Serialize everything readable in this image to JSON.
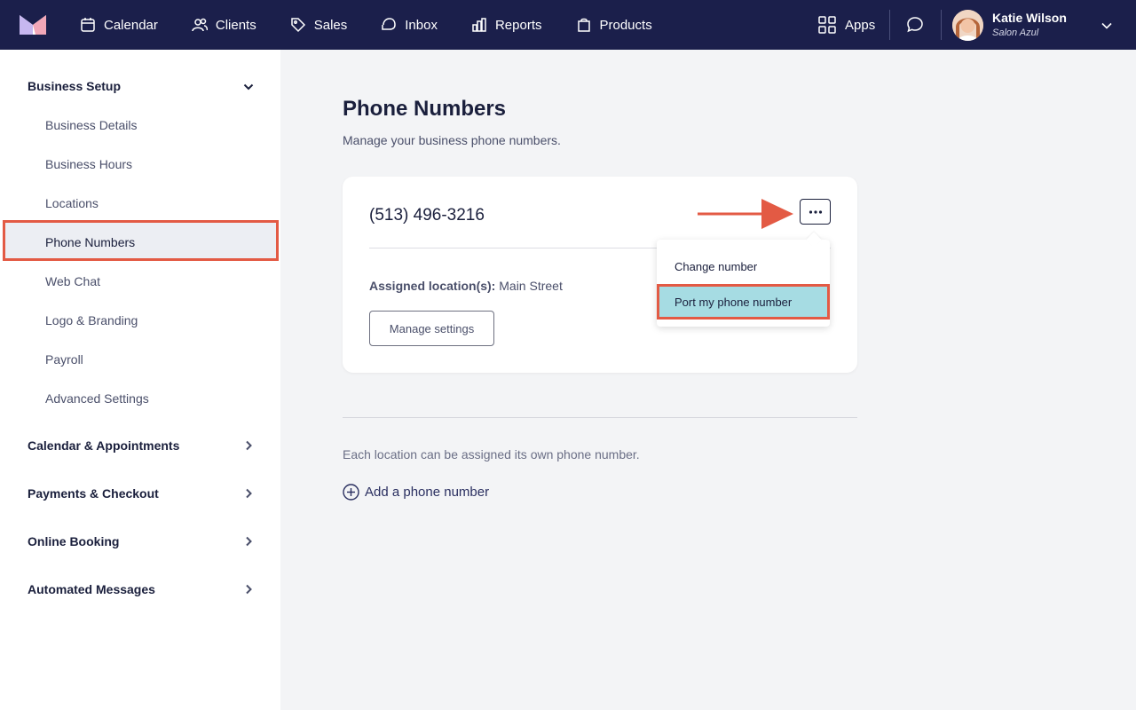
{
  "nav": {
    "items": [
      {
        "label": "Calendar",
        "icon": "calendar-icon"
      },
      {
        "label": "Clients",
        "icon": "clients-icon"
      },
      {
        "label": "Sales",
        "icon": "tag-icon"
      },
      {
        "label": "Inbox",
        "icon": "inbox-icon"
      },
      {
        "label": "Reports",
        "icon": "reports-icon"
      },
      {
        "label": "Products",
        "icon": "bag-icon"
      }
    ],
    "apps_label": "Apps",
    "user_name": "Katie Wilson",
    "user_subtitle": "Salon Azul"
  },
  "sidebar": {
    "business_setup": "Business Setup",
    "items": [
      "Business Details",
      "Business Hours",
      "Locations",
      "Phone Numbers",
      "Web Chat",
      "Logo & Branding",
      "Payroll",
      "Advanced Settings"
    ],
    "sections": [
      "Calendar & Appointments",
      "Payments & Checkout",
      "Online Booking",
      "Automated Messages"
    ]
  },
  "main": {
    "title": "Phone Numbers",
    "subtitle": "Manage your business phone numbers.",
    "card": {
      "phone": "(513) 496-3216",
      "assigned_label": "Assigned location(s):",
      "assigned_value": " Main Street",
      "manage_button": "Manage settings"
    },
    "dropdown": {
      "items": [
        "Change number",
        "Port my phone number"
      ]
    },
    "info_text": "Each location can be assigned its own phone number.",
    "add_link": "Add a phone number"
  },
  "colors": {
    "nav_bg": "#1b1f4b",
    "highlight_border": "#e35a44",
    "highlight_fill": "#a6dce3"
  }
}
